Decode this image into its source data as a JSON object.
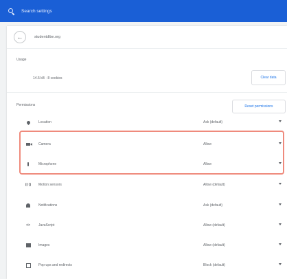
{
  "search": {
    "placeholder": "Search settings"
  },
  "site": {
    "back_glyph": "←",
    "name": "studentdibe.org"
  },
  "usage": {
    "label": "Usage",
    "value": "14.5 kB · 8 cookies",
    "clear_button": "Clear data"
  },
  "permissions": {
    "label": "Permissions",
    "reset_button": "Reset permissions",
    "items": [
      {
        "icon": "location-icon",
        "label": "Location",
        "value": "Ask (default)"
      },
      {
        "icon": "camera-icon",
        "label": "Camera",
        "value": "Allow"
      },
      {
        "icon": "microphone-icon",
        "label": "Microphone",
        "value": "Allow"
      },
      {
        "icon": "motion-sensors-icon",
        "glyph": "((·))",
        "label": "Motion sensors",
        "value": "Allow (default)"
      },
      {
        "icon": "notifications-icon",
        "label": "Notifications",
        "value": "Ask (default)"
      },
      {
        "icon": "javascript-icon",
        "glyph": "<>",
        "label": "JavaScript",
        "value": "Allow (default)"
      },
      {
        "icon": "images-icon",
        "label": "Images",
        "value": "Allow (default)"
      },
      {
        "icon": "popups-icon",
        "label": "Pop-ups and redirects",
        "value": "Block (default)"
      }
    ]
  },
  "colors": {
    "topbar": "#1a5fd6",
    "highlight": "#ef8a7c",
    "link": "#1a73e8"
  }
}
